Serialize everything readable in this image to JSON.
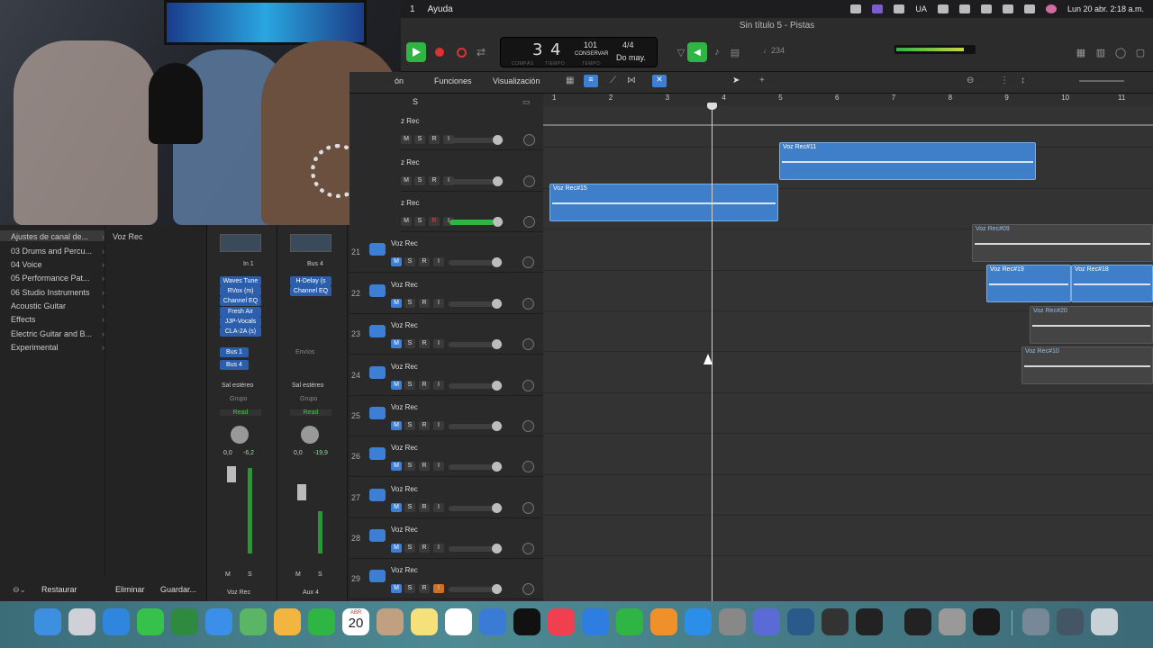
{
  "menubar": {
    "items": [
      "1",
      "Ayuda"
    ],
    "right": [
      "UA",
      "Lun 20 abr.  2:18 a.m."
    ]
  },
  "window": {
    "title": "Sin título 5 - Pistas"
  },
  "lcd": {
    "bar": "3",
    "beat": "4",
    "bar_label": "COMPÁS",
    "beat_label": "TIEMPO",
    "tempo": "101",
    "tempo_mode": "CONSERVAR",
    "tempo_label": "TEMPO",
    "signature": "4/4",
    "key": "Do may.",
    "count_in": "♩234"
  },
  "arrange_menu": {
    "items": [
      "ón",
      "Funciones",
      "Visualización"
    ]
  },
  "ruler": [
    "1",
    "2",
    "3",
    "4",
    "5",
    "6",
    "7",
    "8",
    "9",
    "10",
    "11"
  ],
  "library": {
    "items": [
      "Ajustes de canal de...",
      "03 Drums and Percu...",
      "04 Voice",
      "05 Performance Pat...",
      "06 Studio Instruments",
      "Acoustic Guitar",
      "Effects",
      "Electric Guitar and B...",
      "Experimental"
    ],
    "selected_patch": "Voz Rec",
    "footer": [
      "Restaurar",
      "Eliminar",
      "Guardar..."
    ]
  },
  "strip1": {
    "input": "In 1",
    "plugins": [
      "Waves Tune",
      "RVox (m)",
      "Channel EQ",
      "Fresh Air",
      "JJP-Vocals",
      "CLA-2A (s)"
    ],
    "sends": [
      "Bus 1",
      "Bus 4"
    ],
    "output": "Sal estéreo",
    "group": "Grupo",
    "automation": "Read",
    "pan": "0,0",
    "level": "-6,2",
    "name": "Voz Rec"
  },
  "strip2": {
    "input": "Bus 4",
    "plugins": [
      "H-Delay (s",
      "Channel EQ"
    ],
    "sends_label": "Envíos",
    "output": "Sal estéreo",
    "group": "Grupo",
    "automation": "Read",
    "pan": "0,0",
    "level": "-19,9",
    "name": "Aux 4"
  },
  "tracks": [
    {
      "num": "",
      "name": "z Rec"
    },
    {
      "num": "",
      "name": "z Rec"
    },
    {
      "num": "",
      "name": "z Rec"
    },
    {
      "num": "21",
      "name": "Voz Rec"
    },
    {
      "num": "22",
      "name": "Voz Rec"
    },
    {
      "num": "23",
      "name": "Voz Rec"
    },
    {
      "num": "24",
      "name": "Voz Rec"
    },
    {
      "num": "25",
      "name": "Voz Rec"
    },
    {
      "num": "26",
      "name": "Voz Rec"
    },
    {
      "num": "27",
      "name": "Voz Rec"
    },
    {
      "num": "28",
      "name": "Voz Rec"
    },
    {
      "num": "29",
      "name": "Voz Rec"
    }
  ],
  "track_buttons": {
    "m": "M",
    "s": "S",
    "r": "R",
    "i": "I"
  },
  "regions": [
    "Voz Rec#11",
    "Voz Rec#15",
    "Voz Rec#09",
    "Voz Rec#19",
    "Voz Rec#18",
    "Voz Rec#20",
    "Voz Rec#10"
  ],
  "dock": {
    "calendar_day": "20",
    "calendar_month": "ABR"
  }
}
